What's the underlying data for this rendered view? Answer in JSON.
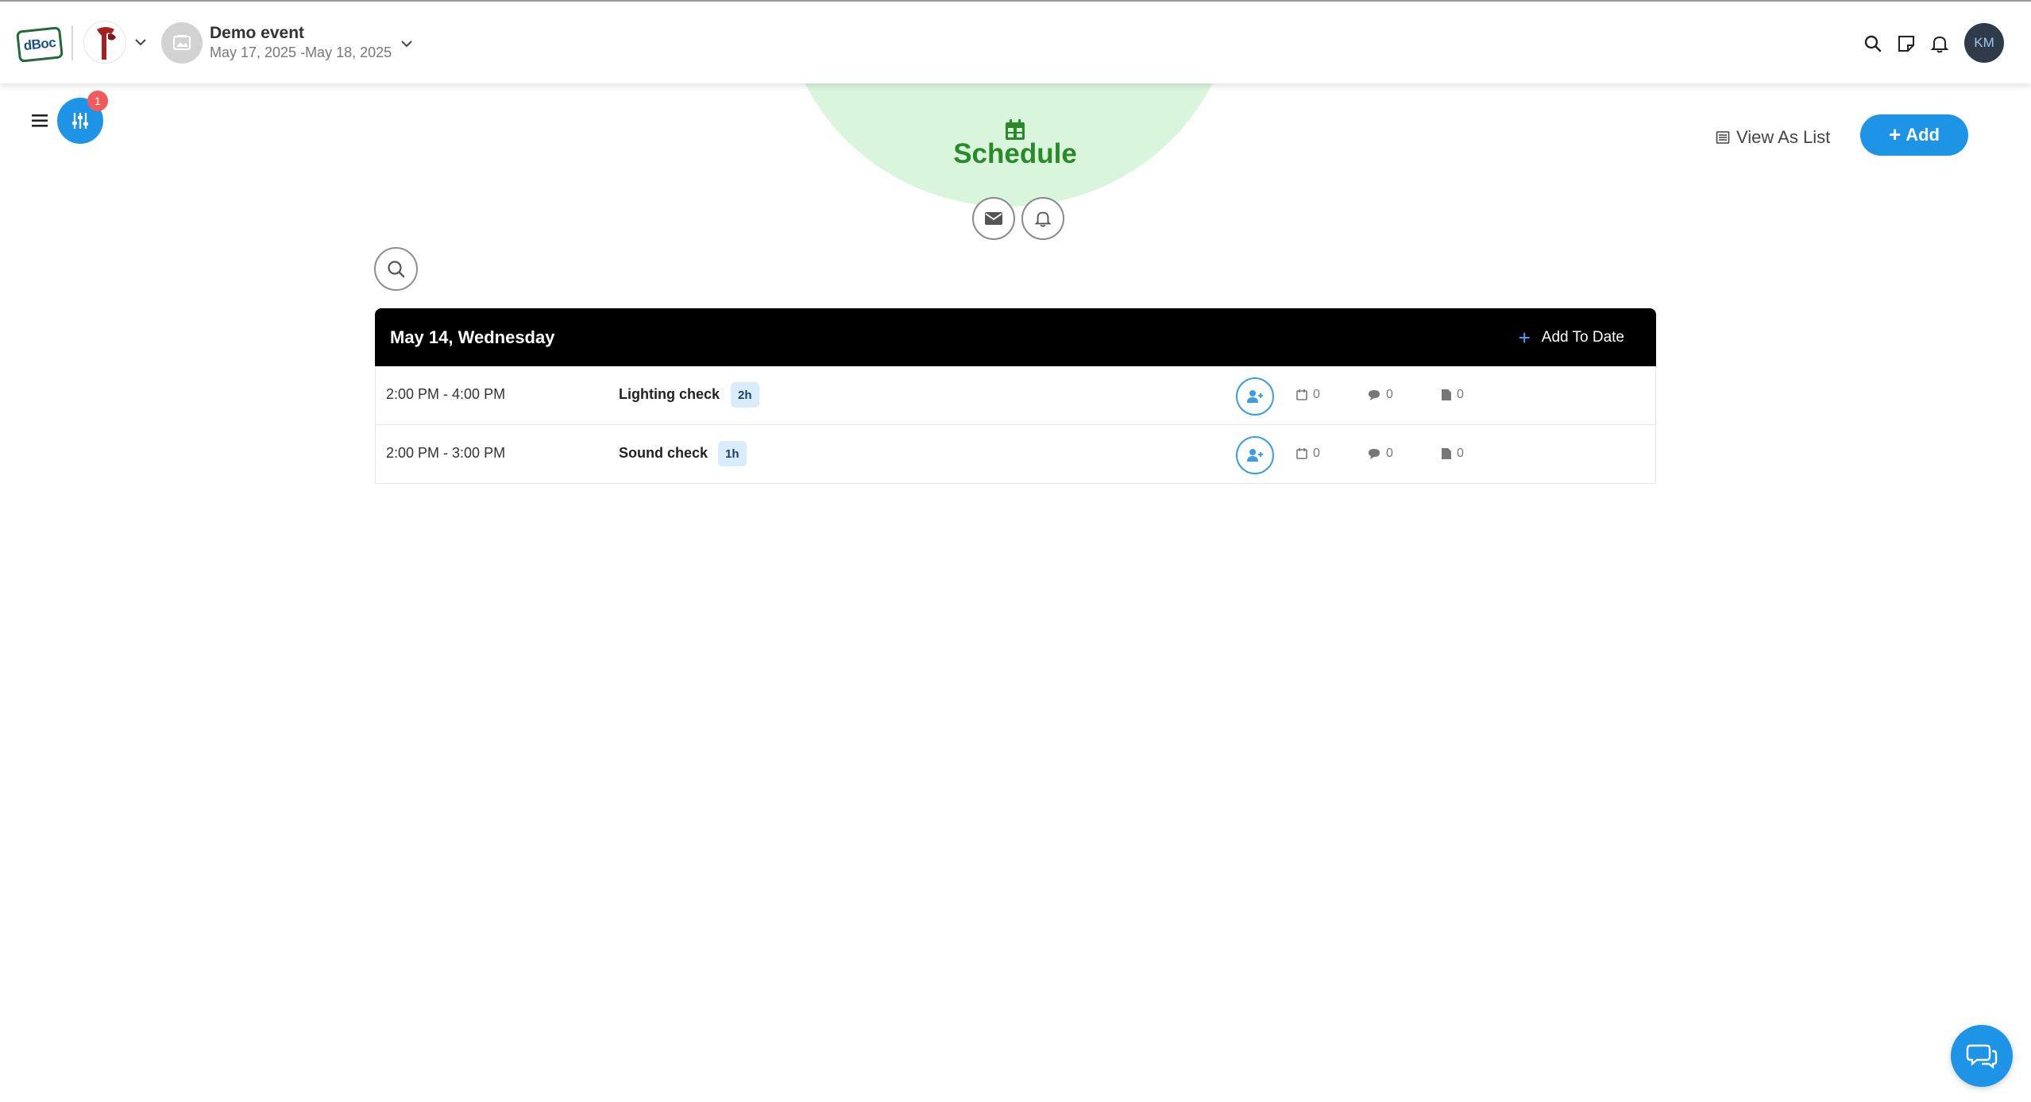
{
  "app": {
    "logo_text": "dBoc"
  },
  "event": {
    "name": "Demo event",
    "dates": "May 17, 2025 -May 18, 2025"
  },
  "user": {
    "initials": "KM"
  },
  "toolbar": {
    "filter_badge_count": "1",
    "view_as_list_label": "View As List",
    "add_label": "Add"
  },
  "page": {
    "title": "Schedule"
  },
  "schedule": {
    "day_title": "May 14, Wednesday",
    "add_to_date_label": "Add To Date",
    "items": [
      {
        "time": "2:00 PM - 4:00 PM",
        "title": "Lighting check",
        "duration": "2h",
        "dates_count": "0",
        "comments_count": "0",
        "files_count": "0"
      },
      {
        "time": "2:00 PM - 3:00 PM",
        "title": "Sound check",
        "duration": "1h",
        "dates_count": "0",
        "comments_count": "0",
        "files_count": "0"
      }
    ]
  },
  "colors": {
    "accent": "#1e94e7",
    "title_green": "#2a8a2a",
    "halo_green": "#d9f6dd",
    "badge_red": "#f25b5b"
  },
  "icons": {
    "topbar": [
      "search-icon",
      "sticky-note-icon",
      "bell-icon"
    ],
    "header": [
      "menu-icon",
      "sliders-icon",
      "calendar-icon",
      "envelope-icon",
      "bell-icon",
      "list-icon",
      "plus-icon"
    ],
    "rows": [
      "user-plus-icon",
      "calendar-icon",
      "comment-icon",
      "file-icon"
    ],
    "chat": "chat-bubbles-icon"
  }
}
